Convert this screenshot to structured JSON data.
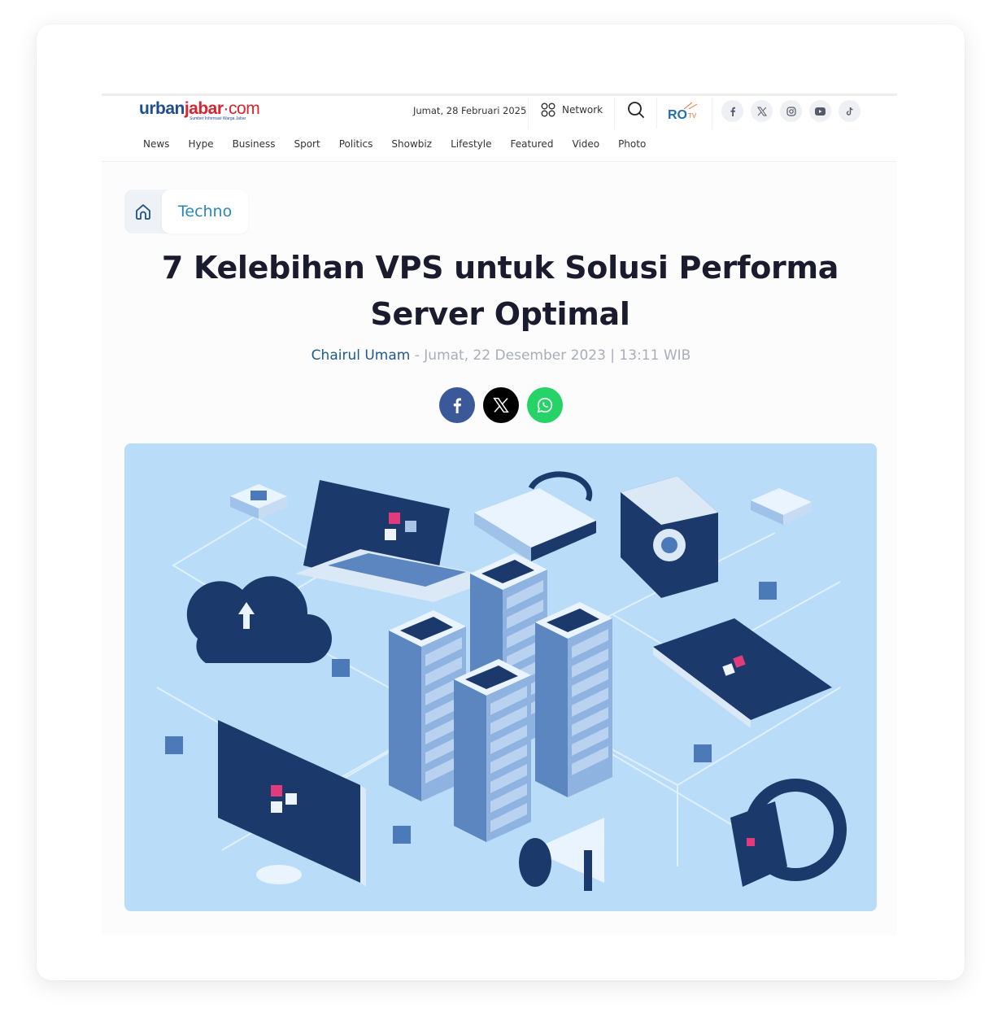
{
  "header": {
    "logo": {
      "part1": "urban",
      "part2": "jabar",
      "part3": "·com",
      "tagline": "Sumber Informasi Warga Jabar"
    },
    "date": "Jumat, 28 Februari 2025",
    "network_label": "Network",
    "icons": {
      "network": "grid-circles-icon",
      "search": "search-icon",
      "partner": "ro-tv-logo"
    },
    "socials": [
      {
        "name": "facebook",
        "glyph": "f"
      },
      {
        "name": "x",
        "glyph": "𝕏"
      },
      {
        "name": "instagram",
        "glyph": "instagram"
      },
      {
        "name": "youtube",
        "glyph": "youtube"
      },
      {
        "name": "tiktok",
        "glyph": "♪"
      }
    ],
    "nav": [
      "News",
      "Hype",
      "Business",
      "Sport",
      "Politics",
      "Showbiz",
      "Lifestyle",
      "Featured",
      "Video",
      "Photo"
    ]
  },
  "article": {
    "breadcrumb": {
      "home_icon": "home-icon",
      "category": "Techno"
    },
    "title": "7 Kelebihan VPS untuk Solusi Performa Server Optimal",
    "author": "Chairul Umam",
    "separator": " - ",
    "published": "Jumat, 22 Desember 2023 | 13:11 WIB",
    "share": [
      {
        "name": "facebook",
        "color": "#3b5998"
      },
      {
        "name": "x",
        "color": "#000000"
      },
      {
        "name": "whatsapp",
        "color": "#25d366"
      }
    ],
    "hero_alt": "Isometric illustration of server racks connected to cloud, laptop, devices"
  },
  "colors": {
    "brand_blue": "#1f4e8c",
    "brand_red": "#d9232e",
    "category": "#2b86b7",
    "title": "#1a1b2e",
    "meta": "#a9adb8",
    "hero_bg": "#b9dcf9"
  }
}
